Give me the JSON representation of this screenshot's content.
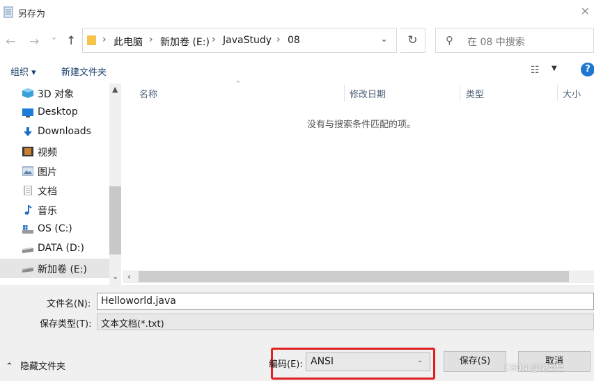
{
  "window": {
    "title": "另存为",
    "close_symbol": "×"
  },
  "nav": {
    "back": "←",
    "forward": "→",
    "history": "⌄",
    "up": "↑"
  },
  "breadcrumb": [
    "此电脑",
    "新加卷 (E:)",
    "JavaStudy",
    "08"
  ],
  "breadcrumb_sep": "›",
  "search": {
    "placeholder": "在 08 中搜索"
  },
  "toolbar": {
    "organize": "组织 ▾",
    "new_folder": "新建文件夹",
    "help": "?"
  },
  "sidebar": {
    "items": [
      {
        "label": "3D 对象",
        "icon": "3d-objects-icon"
      },
      {
        "label": "Desktop",
        "icon": "desktop-icon"
      },
      {
        "label": "Downloads",
        "icon": "downloads-icon"
      },
      {
        "label": "视频",
        "icon": "videos-icon"
      },
      {
        "label": "图片",
        "icon": "pictures-icon"
      },
      {
        "label": "文档",
        "icon": "documents-icon"
      },
      {
        "label": "音乐",
        "icon": "music-icon"
      },
      {
        "label": "OS (C:)",
        "icon": "drive-c-icon"
      },
      {
        "label": "DATA (D:)",
        "icon": "drive-d-icon"
      },
      {
        "label": "新加卷 (E:)",
        "icon": "drive-e-icon",
        "selected": true
      }
    ]
  },
  "columns": [
    "名称",
    "修改日期",
    "类型",
    "大小"
  ],
  "empty_message": "没有与搜索条件匹配的项。",
  "form": {
    "filename_label": "文件名(N):",
    "filename_value": "Helloworld.java",
    "filetype_label": "保存类型(T):",
    "filetype_value": "文本文档(*.txt)",
    "encoding_label": "编码(E):",
    "encoding_value": "ANSI"
  },
  "footer": {
    "hide_folders": "隐藏文件夹",
    "save": "保存(S)",
    "cancel": "取消"
  },
  "watermark": "CSDN @悦星星",
  "colors": {
    "highlight_box": "#e02020",
    "help_icon": "#1f77d0",
    "folder": "#f5c44a"
  }
}
